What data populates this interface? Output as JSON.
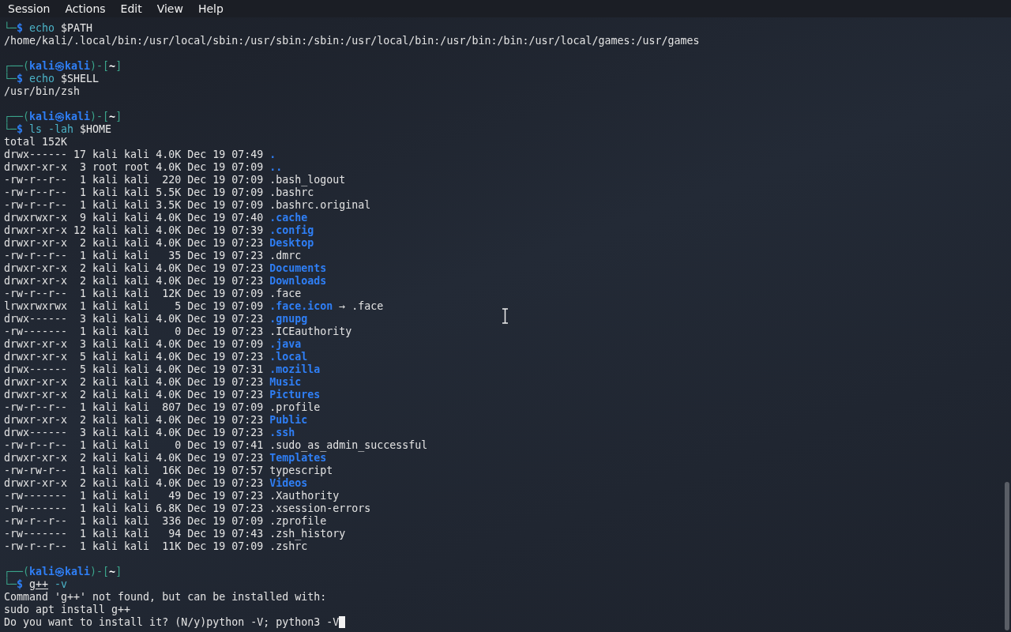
{
  "menu_bar": {
    "items": [
      "Session",
      "Actions",
      "Edit",
      "View",
      "Help"
    ]
  },
  "terminal": {
    "lines": [
      {
        "kind": "text",
        "segments": [
          {
            "text": "└─",
            "kind": "frame"
          },
          {
            "text": "$",
            "kind": "sigil"
          },
          {
            "text": " echo",
            "kind": "command"
          },
          {
            "text": " $PATH",
            "kind": "argument"
          }
        ]
      },
      {
        "kind": "text",
        "segments": [
          {
            "text": "/home/kali/.local/bin:/usr/local/sbin:/usr/sbin:/sbin:/usr/local/bin:/usr/bin:/bin:/usr/local/games:/usr/games",
            "kind": "output"
          }
        ]
      },
      {
        "kind": "blank"
      },
      {
        "kind": "text",
        "segments": [
          {
            "text": "┌──(",
            "kind": "frame"
          },
          {
            "text": "kali㉿kali",
            "kind": "userhost"
          },
          {
            "text": ")-[",
            "kind": "frame"
          },
          {
            "text": "~",
            "kind": "dir"
          },
          {
            "text": "]",
            "kind": "frame"
          }
        ]
      },
      {
        "kind": "text",
        "segments": [
          {
            "text": "└─",
            "kind": "frame"
          },
          {
            "text": "$",
            "kind": "sigil"
          },
          {
            "text": " echo",
            "kind": "command"
          },
          {
            "text": " $SHELL",
            "kind": "argument"
          }
        ]
      },
      {
        "kind": "text",
        "segments": [
          {
            "text": "/usr/bin/zsh",
            "kind": "output"
          }
        ]
      },
      {
        "kind": "blank"
      },
      {
        "kind": "text",
        "segments": [
          {
            "text": "┌──(",
            "kind": "frame"
          },
          {
            "text": "kali㉿kali",
            "kind": "userhost"
          },
          {
            "text": ")-[",
            "kind": "frame"
          },
          {
            "text": "~",
            "kind": "dir"
          },
          {
            "text": "]",
            "kind": "frame"
          }
        ]
      },
      {
        "kind": "text",
        "segments": [
          {
            "text": "└─",
            "kind": "frame"
          },
          {
            "text": "$",
            "kind": "sigil"
          },
          {
            "text": " ls -lah",
            "kind": "command"
          },
          {
            "text": " $HOME",
            "kind": "argument"
          }
        ]
      },
      {
        "kind": "text",
        "segments": [
          {
            "text": "total 152K",
            "kind": "output"
          }
        ]
      },
      {
        "kind": "text",
        "segments": [
          {
            "text": "drwx------ 17 kali kali 4.0K Dec 19 07:49 ",
            "kind": "meta"
          },
          {
            "text": ".",
            "kind": "directory"
          }
        ]
      },
      {
        "kind": "text",
        "segments": [
          {
            "text": "drwxr-xr-x  3 root root 4.0K Dec 19 07:09 ",
            "kind": "meta"
          },
          {
            "text": "..",
            "kind": "directory"
          }
        ]
      },
      {
        "kind": "text",
        "segments": [
          {
            "text": "-rw-r--r--  1 kali kali  220 Dec 19 07:09 ",
            "kind": "meta"
          },
          {
            "text": ".bash_logout",
            "kind": "file"
          }
        ]
      },
      {
        "kind": "text",
        "segments": [
          {
            "text": "-rw-r--r--  1 kali kali 5.5K Dec 19 07:09 ",
            "kind": "meta"
          },
          {
            "text": ".bashrc",
            "kind": "file"
          }
        ]
      },
      {
        "kind": "text",
        "segments": [
          {
            "text": "-rw-r--r--  1 kali kali 3.5K Dec 19 07:09 ",
            "kind": "meta"
          },
          {
            "text": ".bashrc.original",
            "kind": "file"
          }
        ]
      },
      {
        "kind": "text",
        "segments": [
          {
            "text": "drwxrwxr-x  9 kali kali 4.0K Dec 19 07:40 ",
            "kind": "meta"
          },
          {
            "text": ".cache",
            "kind": "directory"
          }
        ]
      },
      {
        "kind": "text",
        "segments": [
          {
            "text": "drwxr-xr-x 12 kali kali 4.0K Dec 19 07:39 ",
            "kind": "meta"
          },
          {
            "text": ".config",
            "kind": "directory"
          }
        ]
      },
      {
        "kind": "text",
        "segments": [
          {
            "text": "drwxr-xr-x  2 kali kali 4.0K Dec 19 07:23 ",
            "kind": "meta"
          },
          {
            "text": "Desktop",
            "kind": "directory"
          }
        ]
      },
      {
        "kind": "text",
        "segments": [
          {
            "text": "-rw-r--r--  1 kali kali   35 Dec 19 07:23 ",
            "kind": "meta"
          },
          {
            "text": ".dmrc",
            "kind": "file"
          }
        ]
      },
      {
        "kind": "text",
        "segments": [
          {
            "text": "drwxr-xr-x  2 kali kali 4.0K Dec 19 07:23 ",
            "kind": "meta"
          },
          {
            "text": "Documents",
            "kind": "directory"
          }
        ]
      },
      {
        "kind": "text",
        "segments": [
          {
            "text": "drwxr-xr-x  2 kali kali 4.0K Dec 19 07:23 ",
            "kind": "meta"
          },
          {
            "text": "Downloads",
            "kind": "directory"
          }
        ]
      },
      {
        "kind": "text",
        "segments": [
          {
            "text": "-rw-r--r--  1 kali kali  12K Dec 19 07:09 ",
            "kind": "meta"
          },
          {
            "text": ".face",
            "kind": "file"
          }
        ]
      },
      {
        "kind": "text",
        "segments": [
          {
            "text": "lrwxrwxrwx  1 kali kali    5 Dec 19 07:09 ",
            "kind": "meta"
          },
          {
            "text": ".face.icon",
            "kind": "directory"
          },
          {
            "text": " → .face",
            "kind": "file"
          }
        ]
      },
      {
        "kind": "text",
        "segments": [
          {
            "text": "drwx------  3 kali kali 4.0K Dec 19 07:23 ",
            "kind": "meta"
          },
          {
            "text": ".gnupg",
            "kind": "directory"
          }
        ]
      },
      {
        "kind": "text",
        "segments": [
          {
            "text": "-rw-------  1 kali kali    0 Dec 19 07:23 ",
            "kind": "meta"
          },
          {
            "text": ".ICEauthority",
            "kind": "file"
          }
        ]
      },
      {
        "kind": "text",
        "segments": [
          {
            "text": "drwxr-xr-x  3 kali kali 4.0K Dec 19 07:09 ",
            "kind": "meta"
          },
          {
            "text": ".java",
            "kind": "directory"
          }
        ]
      },
      {
        "kind": "text",
        "segments": [
          {
            "text": "drwxr-xr-x  5 kali kali 4.0K Dec 19 07:23 ",
            "kind": "meta"
          },
          {
            "text": ".local",
            "kind": "directory"
          }
        ]
      },
      {
        "kind": "text",
        "segments": [
          {
            "text": "drwx------  5 kali kali 4.0K Dec 19 07:31 ",
            "kind": "meta"
          },
          {
            "text": ".mozilla",
            "kind": "directory"
          }
        ]
      },
      {
        "kind": "text",
        "segments": [
          {
            "text": "drwxr-xr-x  2 kali kali 4.0K Dec 19 07:23 ",
            "kind": "meta"
          },
          {
            "text": "Music",
            "kind": "directory"
          }
        ]
      },
      {
        "kind": "text",
        "segments": [
          {
            "text": "drwxr-xr-x  2 kali kali 4.0K Dec 19 07:23 ",
            "kind": "meta"
          },
          {
            "text": "Pictures",
            "kind": "directory"
          }
        ]
      },
      {
        "kind": "text",
        "segments": [
          {
            "text": "-rw-r--r--  1 kali kali  807 Dec 19 07:09 ",
            "kind": "meta"
          },
          {
            "text": ".profile",
            "kind": "file"
          }
        ]
      },
      {
        "kind": "text",
        "segments": [
          {
            "text": "drwxr-xr-x  2 kali kali 4.0K Dec 19 07:23 ",
            "kind": "meta"
          },
          {
            "text": "Public",
            "kind": "directory"
          }
        ]
      },
      {
        "kind": "text",
        "segments": [
          {
            "text": "drwx------  3 kali kali 4.0K Dec 19 07:23 ",
            "kind": "meta"
          },
          {
            "text": ".ssh",
            "kind": "directory"
          }
        ]
      },
      {
        "kind": "text",
        "segments": [
          {
            "text": "-rw-r--r--  1 kali kali    0 Dec 19 07:41 ",
            "kind": "meta"
          },
          {
            "text": ".sudo_as_admin_successful",
            "kind": "file"
          }
        ]
      },
      {
        "kind": "text",
        "segments": [
          {
            "text": "drwxr-xr-x  2 kali kali 4.0K Dec 19 07:23 ",
            "kind": "meta"
          },
          {
            "text": "Templates",
            "kind": "directory"
          }
        ]
      },
      {
        "kind": "text",
        "segments": [
          {
            "text": "-rw-rw-r--  1 kali kali  16K Dec 19 07:57 ",
            "kind": "meta"
          },
          {
            "text": "typescript",
            "kind": "file"
          }
        ]
      },
      {
        "kind": "text",
        "segments": [
          {
            "text": "drwxr-xr-x  2 kali kali 4.0K Dec 19 07:23 ",
            "kind": "meta"
          },
          {
            "text": "Videos",
            "kind": "directory"
          }
        ]
      },
      {
        "kind": "text",
        "segments": [
          {
            "text": "-rw-------  1 kali kali   49 Dec 19 07:23 ",
            "kind": "meta"
          },
          {
            "text": ".Xauthority",
            "kind": "file"
          }
        ]
      },
      {
        "kind": "text",
        "segments": [
          {
            "text": "-rw-------  1 kali kali 6.8K Dec 19 07:23 ",
            "kind": "meta"
          },
          {
            "text": ".xsession-errors",
            "kind": "file"
          }
        ]
      },
      {
        "kind": "text",
        "segments": [
          {
            "text": "-rw-r--r--  1 kali kali  336 Dec 19 07:09 ",
            "kind": "meta"
          },
          {
            "text": ".zprofile",
            "kind": "file"
          }
        ]
      },
      {
        "kind": "text",
        "segments": [
          {
            "text": "-rw-------  1 kali kali   94 Dec 19 07:43 ",
            "kind": "meta"
          },
          {
            "text": ".zsh_history",
            "kind": "file"
          }
        ]
      },
      {
        "kind": "text",
        "segments": [
          {
            "text": "-rw-r--r--  1 kali kali  11K Dec 19 07:09 ",
            "kind": "meta"
          },
          {
            "text": ".zshrc",
            "kind": "file"
          }
        ]
      },
      {
        "kind": "blank"
      },
      {
        "kind": "text",
        "segments": [
          {
            "text": "┌──(",
            "kind": "frame"
          },
          {
            "text": "kali㉿kali",
            "kind": "userhost"
          },
          {
            "text": ")-[",
            "kind": "frame"
          },
          {
            "text": "~",
            "kind": "dir"
          },
          {
            "text": "]",
            "kind": "frame"
          }
        ]
      },
      {
        "kind": "text",
        "segments": [
          {
            "text": "└─",
            "kind": "frame"
          },
          {
            "text": "$ ",
            "kind": "sigil"
          },
          {
            "text": "g++",
            "kind": "unknown"
          },
          {
            "text": " -v",
            "kind": "command"
          }
        ]
      },
      {
        "kind": "text",
        "segments": [
          {
            "text": "Command 'g++' not found, but can be installed with:",
            "kind": "output"
          }
        ]
      },
      {
        "kind": "text",
        "segments": [
          {
            "text": "sudo apt install g++",
            "kind": "output"
          }
        ]
      },
      {
        "kind": "text",
        "cursor": true,
        "segments": [
          {
            "text": "Do you want to install it? (N/y)python -V; python3 -V",
            "kind": "output"
          }
        ]
      }
    ]
  }
}
